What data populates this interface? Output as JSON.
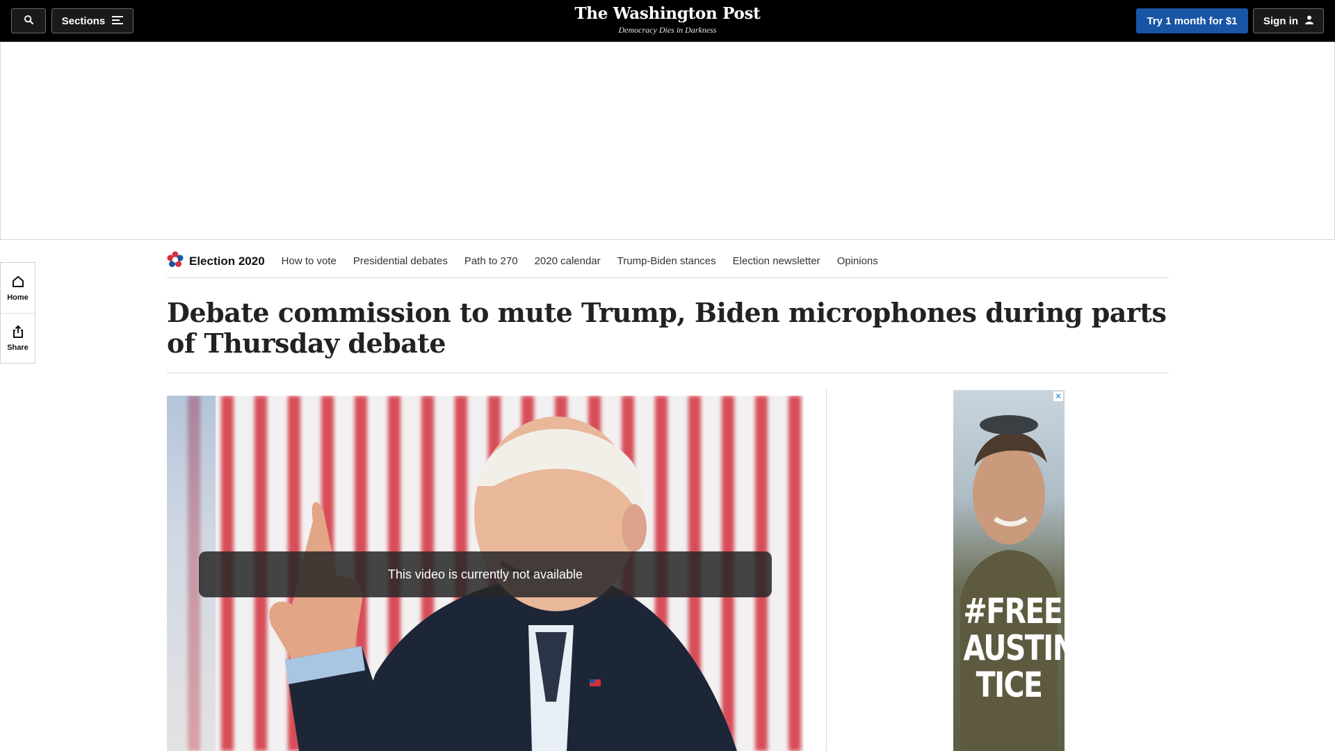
{
  "header": {
    "sections_label": "Sections",
    "logo_name": "The Washington Post",
    "logo_tagline": "Democracy Dies in Darkness",
    "try_label": "Try 1 month for $1",
    "signin_label": "Sign in"
  },
  "rail": {
    "home_label": "Home",
    "share_label": "Share"
  },
  "election_nav": {
    "title": "Election 2020",
    "links": [
      "How to vote",
      "Presidential debates",
      "Path to 270",
      "2020 calendar",
      "Trump-Biden stances",
      "Election newsletter",
      "Opinions"
    ]
  },
  "article": {
    "headline": "Debate commission to mute Trump, Biden microphones during parts of Thursday debate"
  },
  "video": {
    "message": "This video is currently not available"
  },
  "side_ad": {
    "close_symbol": "✕",
    "text_line1": "#FREE",
    "text_line2": "AUSTIN",
    "text_line3": "TICE"
  },
  "colors": {
    "topbar": "#000000",
    "accent_blue": "#1955a5",
    "flag_red": "#d2313d"
  }
}
